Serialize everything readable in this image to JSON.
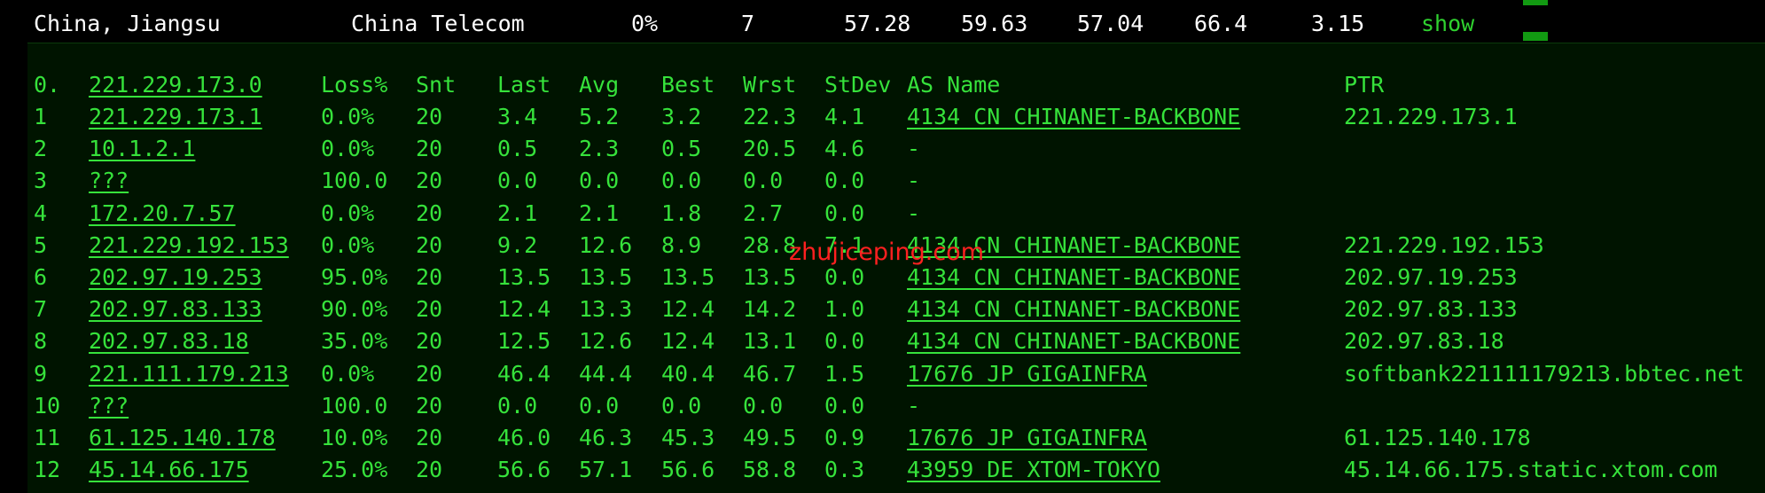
{
  "summary": {
    "location": "China, Jiangsu",
    "isp": "China Telecom",
    "loss": "0%",
    "hops": "7",
    "v1": "57.28",
    "v2": "59.63",
    "v3": "57.04",
    "v4": "66.4",
    "v5": "3.15",
    "show_label": "show"
  },
  "colors": {
    "background": "#000000",
    "panel_background": "#001400",
    "terminal_green": "#36e23b",
    "link_green": "#2fd12f",
    "block_green": "#129a12",
    "watermark_red": "#ff2020"
  },
  "headers": {
    "hop": "0.",
    "host": "221.229.173.0",
    "loss": "Loss%",
    "snt": "Snt",
    "last": "Last",
    "avg": "Avg",
    "best": "Best",
    "wrst": "Wrst",
    "stdev": "StDev",
    "as_name": "AS Name",
    "ptr": "PTR"
  },
  "hops": [
    {
      "hop": "1",
      "host": "221.229.173.1",
      "loss": "0.0%",
      "snt": "20",
      "last": "3.4",
      "avg": "5.2",
      "best": "3.2",
      "wrst": "22.3",
      "stdev": "4.1",
      "as_name": "4134  CN CHINANET-BACKBONE",
      "ptr": "221.229.173.1"
    },
    {
      "hop": "2",
      "host": "10.1.2.1",
      "loss": "0.0%",
      "snt": "20",
      "last": "0.5",
      "avg": "2.3",
      "best": "0.5",
      "wrst": "20.5",
      "stdev": "4.6",
      "as_name": "-",
      "ptr": ""
    },
    {
      "hop": "3",
      "host": "???",
      "loss": "100.0",
      "snt": "20",
      "last": "0.0",
      "avg": "0.0",
      "best": "0.0",
      "wrst": "0.0",
      "stdev": "0.0",
      "as_name": "-",
      "ptr": ""
    },
    {
      "hop": "4",
      "host": "172.20.7.57",
      "loss": "0.0%",
      "snt": "20",
      "last": "2.1",
      "avg": "2.1",
      "best": "1.8",
      "wrst": "2.7",
      "stdev": "0.0",
      "as_name": "-",
      "ptr": ""
    },
    {
      "hop": "5",
      "host": "221.229.192.153",
      "loss": "0.0%",
      "snt": "20",
      "last": "9.2",
      "avg": "12.6",
      "best": "8.9",
      "wrst": "28.8",
      "stdev": "7.1",
      "as_name": "4134  CN CHINANET-BACKBONE",
      "ptr": "221.229.192.153"
    },
    {
      "hop": "6",
      "host": "202.97.19.253",
      "loss": "95.0%",
      "snt": "20",
      "last": "13.5",
      "avg": "13.5",
      "best": "13.5",
      "wrst": "13.5",
      "stdev": "0.0",
      "as_name": "4134  CN CHINANET-BACKBONE",
      "ptr": "202.97.19.253"
    },
    {
      "hop": "7",
      "host": "202.97.83.133",
      "loss": "90.0%",
      "snt": "20",
      "last": "12.4",
      "avg": "13.3",
      "best": "12.4",
      "wrst": "14.2",
      "stdev": "1.0",
      "as_name": "4134  CN CHINANET-BACKBONE",
      "ptr": "202.97.83.133"
    },
    {
      "hop": "8",
      "host": "202.97.83.18",
      "loss": "35.0%",
      "snt": "20",
      "last": "12.5",
      "avg": "12.6",
      "best": "12.4",
      "wrst": "13.1",
      "stdev": "0.0",
      "as_name": "4134  CN CHINANET-BACKBONE",
      "ptr": "202.97.83.18"
    },
    {
      "hop": "9",
      "host": "221.111.179.213",
      "loss": "0.0%",
      "snt": "20",
      "last": "46.4",
      "avg": "44.4",
      "best": "40.4",
      "wrst": "46.7",
      "stdev": "1.5",
      "as_name": "17676 JP GIGAINFRA",
      "ptr": "softbank221111179213.bbtec.net"
    },
    {
      "hop": "10",
      "host": "???",
      "loss": "100.0",
      "snt": "20",
      "last": "0.0",
      "avg": "0.0",
      "best": "0.0",
      "wrst": "0.0",
      "stdev": "0.0",
      "as_name": "-",
      "ptr": ""
    },
    {
      "hop": "11",
      "host": "61.125.140.178",
      "loss": "10.0%",
      "snt": "20",
      "last": "46.0",
      "avg": "46.3",
      "best": "45.3",
      "wrst": "49.5",
      "stdev": "0.9",
      "as_name": "17676 JP GIGAINFRA",
      "ptr": "61.125.140.178"
    },
    {
      "hop": "12",
      "host": "45.14.66.175",
      "loss": "25.0%",
      "snt": "20",
      "last": "56.6",
      "avg": "57.1",
      "best": "56.6",
      "wrst": "58.8",
      "stdev": "0.3",
      "as_name": "43959 DE XTOM-TOKYO",
      "ptr": "45.14.66.175.static.xtom.com"
    }
  ],
  "watermark": "zhujiceping.com"
}
